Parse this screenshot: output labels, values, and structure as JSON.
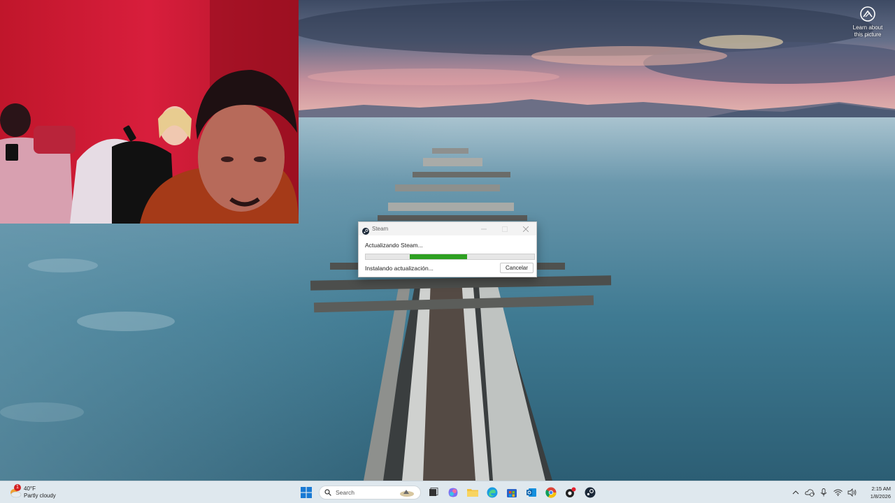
{
  "desktop": {
    "learn_about_line1": "Learn about",
    "learn_about_line2": "this picture"
  },
  "steam_dialog": {
    "title": "Steam",
    "heading": "Actualizando Steam...",
    "status": "Instalando actualización...",
    "cancel_label": "Cancelar",
    "progress": {
      "start": 0.26,
      "end": 0.6
    },
    "accent_color": "#2ea021"
  },
  "taskbar": {
    "weather": {
      "badge": "1",
      "temperature": "40°F",
      "condition": "Partly cloudy"
    },
    "search_placeholder": "Search",
    "pinned_icons": [
      "windows-start",
      "search",
      "task-view",
      "copilot",
      "file-explorer",
      "edge",
      "microsoft-store",
      "outlook",
      "chrome",
      "app-with-notification",
      "steam"
    ],
    "tray_icons": [
      "chevron-up",
      "onedrive",
      "microphone",
      "wifi",
      "speaker"
    ],
    "clock": {
      "time": "2:15 AM",
      "date": "1/8/2026"
    }
  }
}
